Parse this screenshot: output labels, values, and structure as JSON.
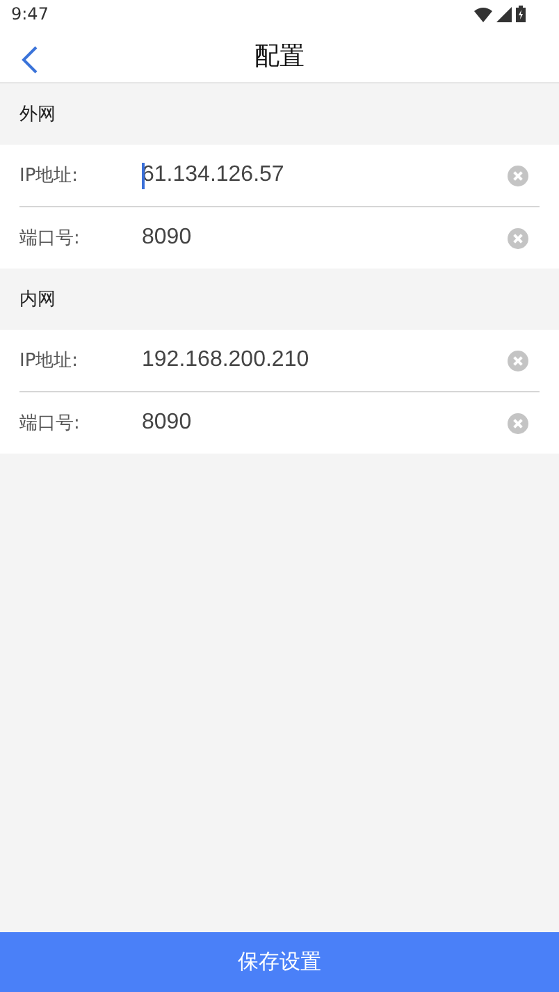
{
  "status_bar": {
    "time": "9:47"
  },
  "nav": {
    "title": "配置"
  },
  "sections": [
    {
      "title": "外网",
      "fields": [
        {
          "label": "IP地址:",
          "value": "61.134.126.57",
          "focused": true
        },
        {
          "label": "端口号:",
          "value": "8090",
          "focused": false
        }
      ]
    },
    {
      "title": "内网",
      "fields": [
        {
          "label": "IP地址:",
          "value": "192.168.200.210",
          "focused": false
        },
        {
          "label": "端口号:",
          "value": "8090",
          "focused": false
        }
      ]
    }
  ],
  "save_button": {
    "label": "保存设置"
  }
}
